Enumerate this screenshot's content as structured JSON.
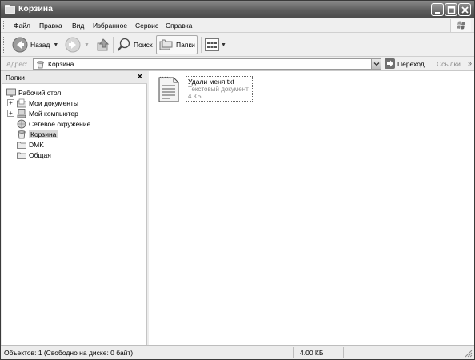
{
  "window": {
    "title": "Корзина"
  },
  "menu": {
    "items": [
      {
        "label": "Файл"
      },
      {
        "label": "Правка"
      },
      {
        "label": "Вид"
      },
      {
        "label": "Избранное"
      },
      {
        "label": "Сервис"
      },
      {
        "label": "Справка"
      }
    ]
  },
  "toolbar": {
    "back_label": "Назад",
    "search_label": "Поиск",
    "folders_label": "Папки"
  },
  "address": {
    "label": "Адрес:",
    "value": "Корзина",
    "go_label": "Переход",
    "links_label": "Ссылки"
  },
  "folders_pane": {
    "title": "Папки",
    "close_glyph": "×",
    "items": [
      {
        "label": "Рабочий стол",
        "icon": "desktop-icon"
      },
      {
        "label": "Мои документы",
        "icon": "my-documents-icon"
      },
      {
        "label": "Мой компьютер",
        "icon": "my-computer-icon"
      },
      {
        "label": "Сетевое окружение",
        "icon": "network-icon"
      },
      {
        "label": "Корзина",
        "icon": "recycle-bin-icon"
      },
      {
        "label": "DMK",
        "icon": "folder-icon"
      },
      {
        "label": "Общая",
        "icon": "folder-icon"
      }
    ]
  },
  "content": {
    "files": [
      {
        "name": "Удали меня.txt",
        "type": "Текстовый документ",
        "size": "4 КБ",
        "icon": "text-file-icon"
      }
    ]
  },
  "status": {
    "objects": "Объектов: 1 (Свободно на диске: 0 байт)",
    "size": "4.00 КБ"
  }
}
